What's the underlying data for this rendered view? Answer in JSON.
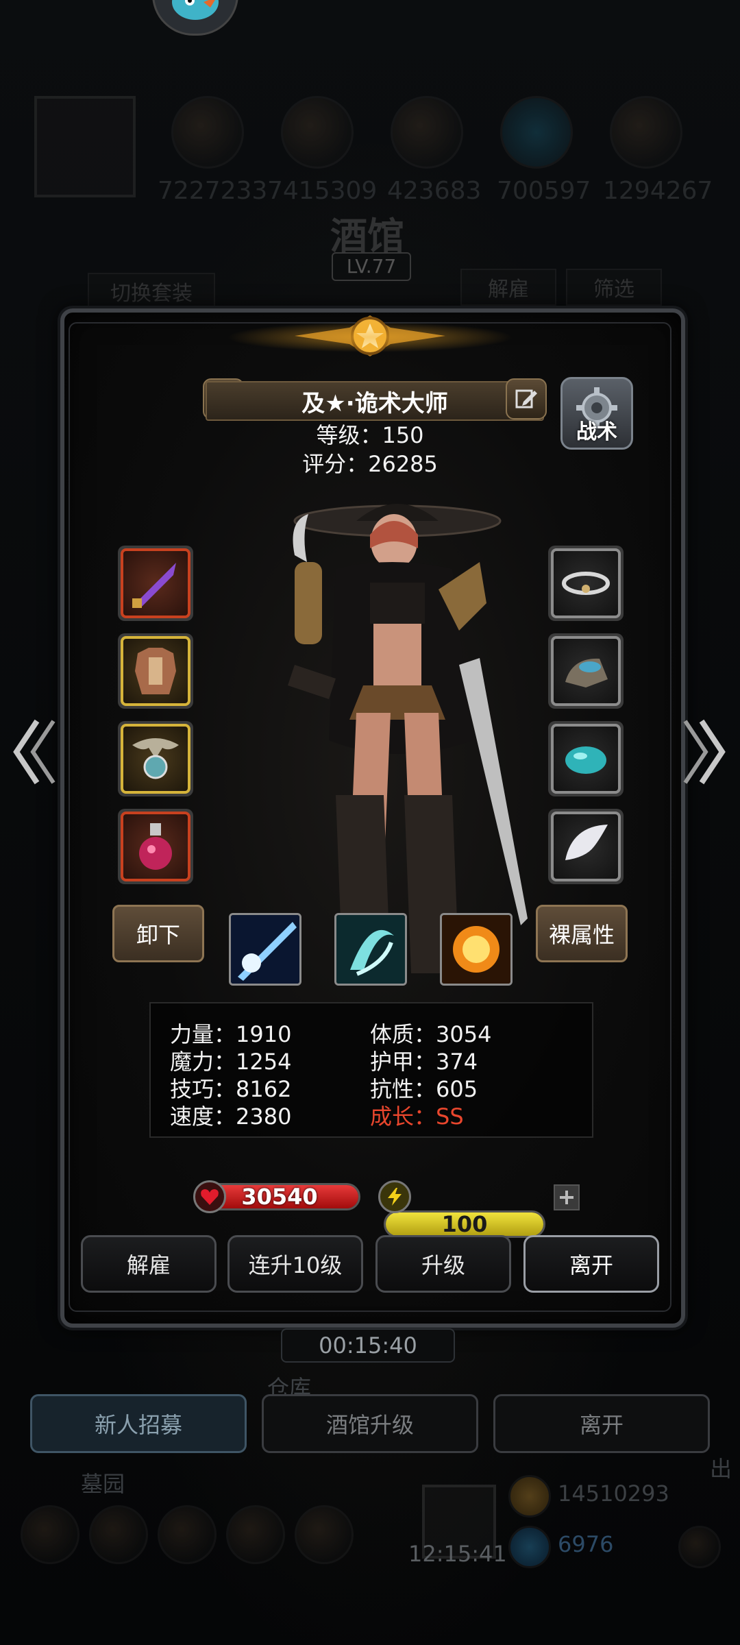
{
  "background": {
    "resources": [
      "7227233",
      "7415309",
      "423683",
      "700597",
      "1294267"
    ],
    "tavern_title": "酒馆",
    "tavern_level": "LV.77",
    "switch_outfit": "切换套装",
    "dismiss": "解雇",
    "filter": "筛选",
    "timer": "00:15:40",
    "warehouse": "仓库",
    "graveyard": "墓园",
    "bottom_tabs": [
      "新人招募",
      "酒馆升级",
      "离开"
    ],
    "clock": "12:15:41",
    "currency_gold": "14510293",
    "currency_gem": "6976",
    "exit_hint": "出"
  },
  "hero": {
    "name": "及★·诡术大师",
    "level_text": "等级：150",
    "score_text": "评分：26285",
    "tactics_label": "战术"
  },
  "equipment": {
    "left": [
      "dagger",
      "chest-armor",
      "amulet",
      "potion"
    ],
    "right": [
      "cloud-ring",
      "glove",
      "gem",
      "wing"
    ]
  },
  "buttons": {
    "unequip": "卸下",
    "base_attributes": "裸属性"
  },
  "skills": [
    "light-beam",
    "whirlwind",
    "explosion"
  ],
  "stats": {
    "strength": "力量：1910",
    "constitution": "体质：3054",
    "magic": "魔力：1254",
    "armor": "护甲：374",
    "skill": "技巧：8162",
    "resistance": "抗性：605",
    "speed": "速度：2380",
    "growth": "成长：SS"
  },
  "bars": {
    "hp": "30540",
    "energy": "100",
    "hp_color": "#d11a1a",
    "energy_color": "#e1d21d"
  },
  "actions": [
    "解雇",
    "连升10级",
    "升级",
    "离开"
  ]
}
